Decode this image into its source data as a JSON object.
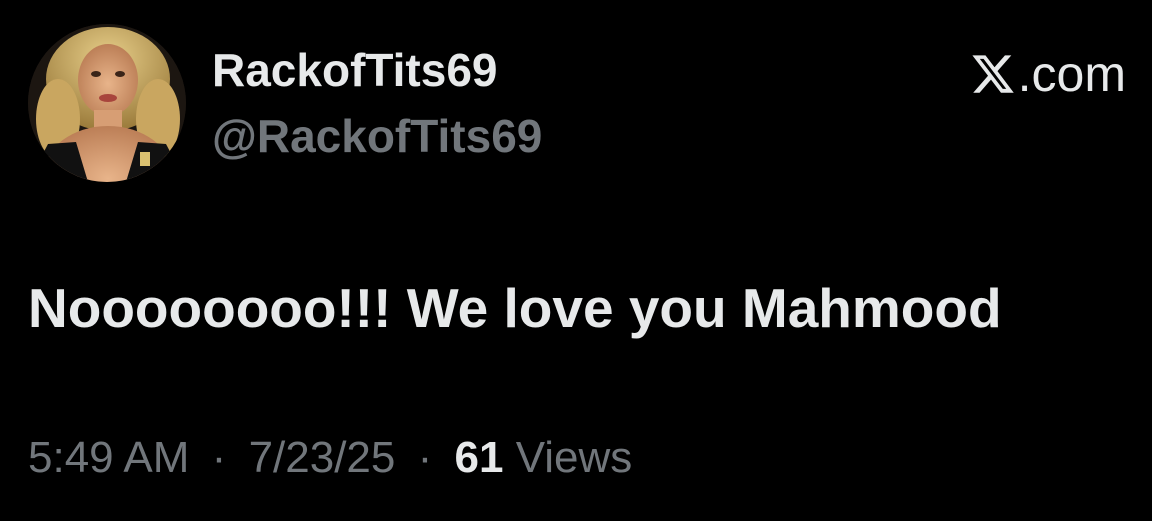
{
  "author": {
    "display_name": "RackofTits69",
    "handle": "@RackofTits69",
    "avatar_icon": "profile-photo"
  },
  "brand": {
    "icon": "x-logo-icon",
    "suffix": ".com"
  },
  "tweet": {
    "text": "Noooooooo!!! We love you Mahmood"
  },
  "meta": {
    "time": "5:49 AM",
    "separator": "·",
    "date": "7/23/25",
    "views_count": "61",
    "views_label": "Views"
  },
  "colors": {
    "background": "#000000",
    "primary_text": "#e7e9ea",
    "secondary_text": "#71767b"
  }
}
